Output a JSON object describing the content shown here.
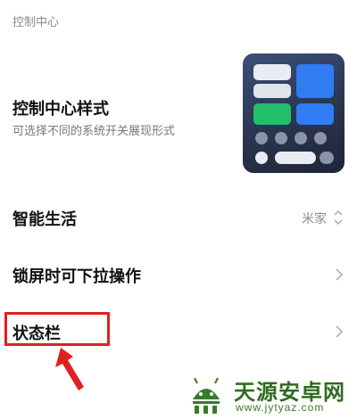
{
  "section": {
    "title": "控制中心"
  },
  "style_row": {
    "title": "控制中心样式",
    "subtitle": "可选择不同的系统开关展现形式"
  },
  "smart_row": {
    "title": "智能生活",
    "value": "米家"
  },
  "lock_row": {
    "title": "锁屏时可下拉操作"
  },
  "status_row": {
    "title": "状态栏"
  },
  "watermark": {
    "name": "天源安卓网",
    "url": "www.jytyaz.com"
  },
  "colors": {
    "tile_white": "#e9ecf2",
    "tile_blue": "#2f7cf3",
    "tile_green": "#22c06a",
    "highlight_red": "#e02020",
    "chevron": "#b0b0b0"
  },
  "icons": {
    "updown": "chevron-updown-icon",
    "chevron": "chevron-right-icon",
    "arrow": "red-arrow-icon"
  }
}
